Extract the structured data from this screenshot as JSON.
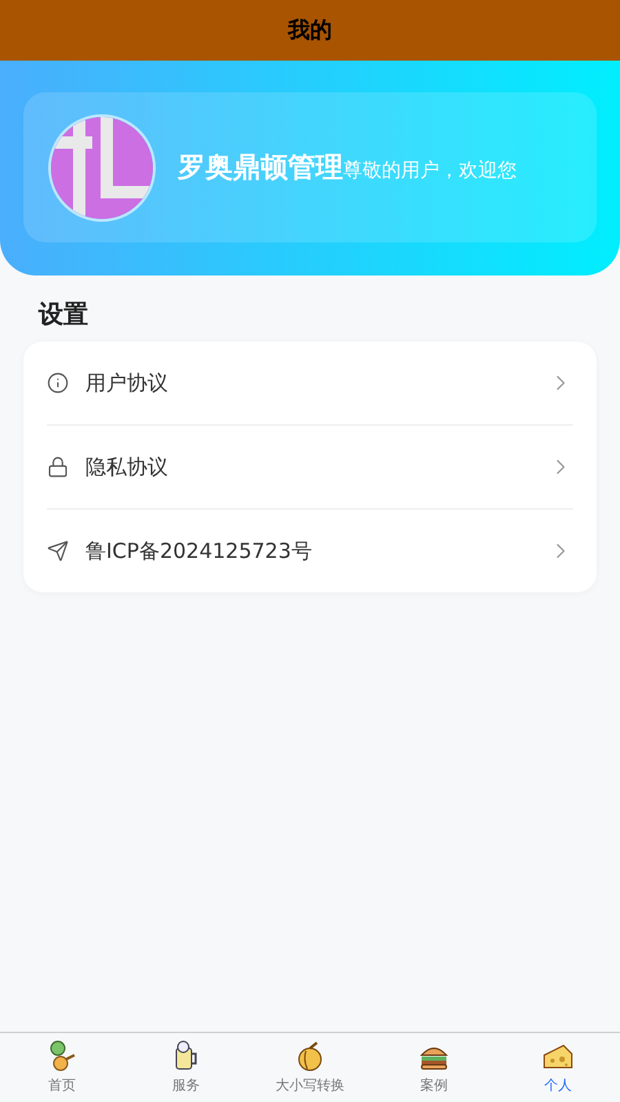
{
  "header": {
    "title": "我的"
  },
  "profile": {
    "name": "罗奥鼎顿管理",
    "greeting": "尊敬的用户，欢迎您"
  },
  "settings": {
    "title": "设置",
    "items": [
      {
        "kind": "info",
        "label": "用户协议"
      },
      {
        "kind": "lock",
        "label": "隐私协议"
      },
      {
        "kind": "send",
        "label": "鲁ICP备2024125723号"
      }
    ]
  },
  "tabs": [
    {
      "kind": "drumstick",
      "label": "首页",
      "selected": false
    },
    {
      "kind": "beer",
      "label": "服务",
      "selected": false
    },
    {
      "kind": "pepper",
      "label": "大小写转换",
      "selected": false
    },
    {
      "kind": "burger",
      "label": "案例",
      "selected": false
    },
    {
      "kind": "cheese",
      "label": "个人",
      "selected": true
    }
  ]
}
